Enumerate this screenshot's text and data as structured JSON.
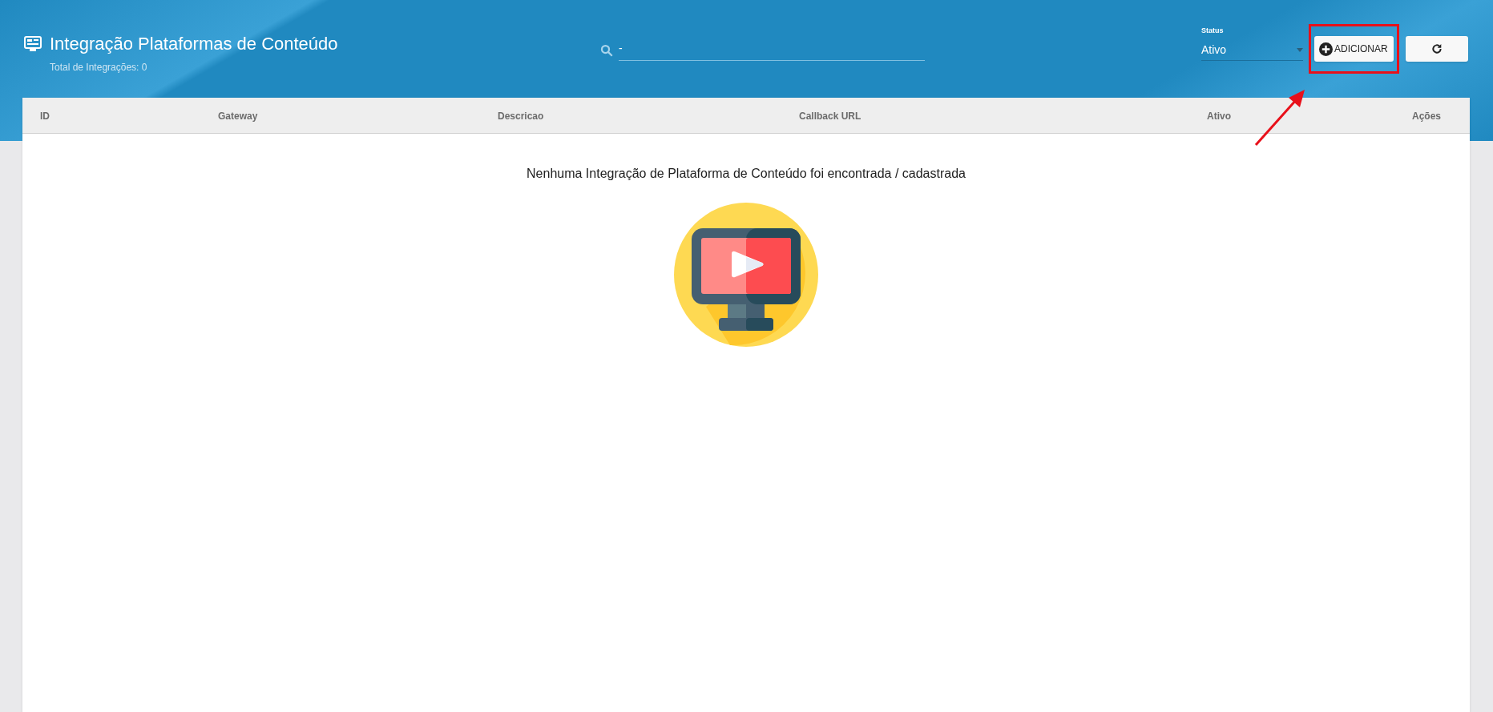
{
  "header": {
    "title": "Integração Plataformas de Conteúdo",
    "subtitle": "Total de Integrações: 0"
  },
  "search": {
    "value": "-"
  },
  "status_filter": {
    "label": "Status",
    "value": "Ativo"
  },
  "add_button": {
    "label": "ADICIONAR",
    "highlighted": true
  },
  "table": {
    "columns": [
      {
        "label": "ID"
      },
      {
        "label": "Gateway"
      },
      {
        "label": "Descricao"
      },
      {
        "label": "Callback URL"
      },
      {
        "label": "Ativo"
      },
      {
        "label": "Ações"
      }
    ],
    "empty_message": "Nenhuma Integração de Plataforma de Conteúdo foi encontrada / cadastrada"
  }
}
